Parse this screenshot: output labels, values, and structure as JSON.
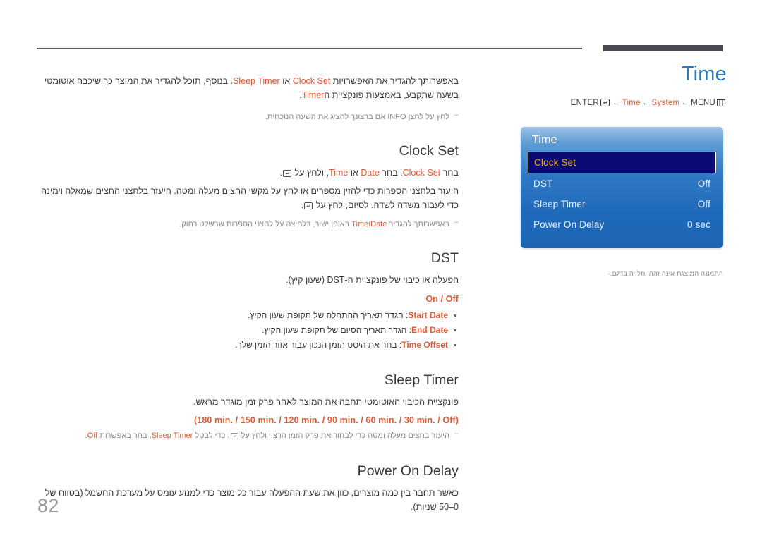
{
  "page": {
    "number": "82"
  },
  "header": {
    "title": "Time",
    "breadcrumb": {
      "enter_label": "ENTER",
      "enter_icon": "enter-key-icon",
      "arrow": "←",
      "crumb_time": "Time",
      "crumb_system": "System",
      "menu_label": "MENU",
      "menu_icon": "menu-grid-icon"
    }
  },
  "osd": {
    "title": "Time",
    "items": [
      {
        "label": "Clock Set",
        "value": "",
        "selected": true
      },
      {
        "label": "DST",
        "value": "Off",
        "selected": false
      },
      {
        "label": "Sleep Timer",
        "value": "Off",
        "selected": false
      },
      {
        "label": "Power On Delay",
        "value": "0 sec",
        "selected": false
      }
    ],
    "note": "התמונה המוצגת אינה זהה ותלויה בדגם.",
    "note_dash": "-"
  },
  "intro": {
    "line1_part1": "באפשרותך להגדיר את האפשרויות",
    "term_clock_set": "Clock Set",
    "or": "או",
    "term_sleep_timer": "Sleep Timer",
    "line1_part2": ". בנוסף, תוכל להגדיר את המוצר כך שיכבה אוטומטי בשעה שתקבע,",
    "line2_part1": "באמצעות פונקציית ה",
    "term_timer": "Timer",
    "line2_part2": ".",
    "note": "לחץ על לחצן INFO אם ברצונך להציג את השעה הנוכחית."
  },
  "sections": [
    {
      "heading": "Clock Set",
      "para1_a": "בחר",
      "para1_term1": "Clock Set",
      "para1_b": ". בחר",
      "para1_term2": "Date",
      "para1_c": "או",
      "para1_term3": "Time",
      "para1_d": ", ולחץ על",
      "para1_e": ".",
      "para2_a": "היעזר בלחצני הספרות כדי להזין מספרים או לחץ על מקשי החצים מעלה ומטה. היעזר בלחצני החצים שמאלה וימינה כדי לעבור משדה",
      "para2_b": "לשדה. לסיום, לחץ על",
      "para2_c": ".",
      "note_a": "באפשרותך להגדיר",
      "note_term1": "Date",
      "note_term_join": "ו",
      "note_term2": "Time",
      "note_b": "באופן ישיר, בלחיצה על לחצני הספרות שבשלט רחוק."
    },
    {
      "heading": "DST",
      "para1": "הפעלה או כיבוי של פונקציית ה-DST (שעון קיץ).",
      "values": "On / Off",
      "bullets": [
        {
          "term": "Start Date",
          "text": ": הגדר תאריך ההתחלה של תקופת שעון הקיץ."
        },
        {
          "term": "End Date",
          "text": ": הגדר תאריך הסיום של תקופת שעון הקיץ."
        },
        {
          "term": "Time Offset",
          "text": ": בחר את היסט הזמן הנכון עבור אזור הזמן שלך."
        }
      ]
    },
    {
      "heading": "Sleep Timer",
      "para1": "פונקציית הכיבוי האוטומטי תחבה את המוצר לאחר פרק זמן מוגדר מראש.",
      "values": "(180 min. / 150 min. / 120 min. / 90 min. / 60 min. / 30 min. / Off)",
      "note_a": "היעזר בחצים מעלה ומטה כדי לבחור את פרק הזמן הרצוי ולחץ על",
      "note_b": ". כדי לבטל",
      "note_term1": "Sleep Timer",
      "note_c": ", בחר באפשרות",
      "note_term2": "Off",
      "note_d": "."
    },
    {
      "heading": "Power On Delay",
      "para1": "כאשר תחבר בין כמה מוצרים, כוון את שעת ההפעלה עבור כל מוצר כדי למנוע עומס על מערכת החשמל (בטווח של 0–50 שניות)."
    }
  ],
  "colors": {
    "accent": "#e05a34",
    "title_blue": "#2a7ac4",
    "osd_selected_bg": "#0a0a74",
    "osd_selected_text": "#f0a830",
    "rule_dark": "#4a4852"
  }
}
